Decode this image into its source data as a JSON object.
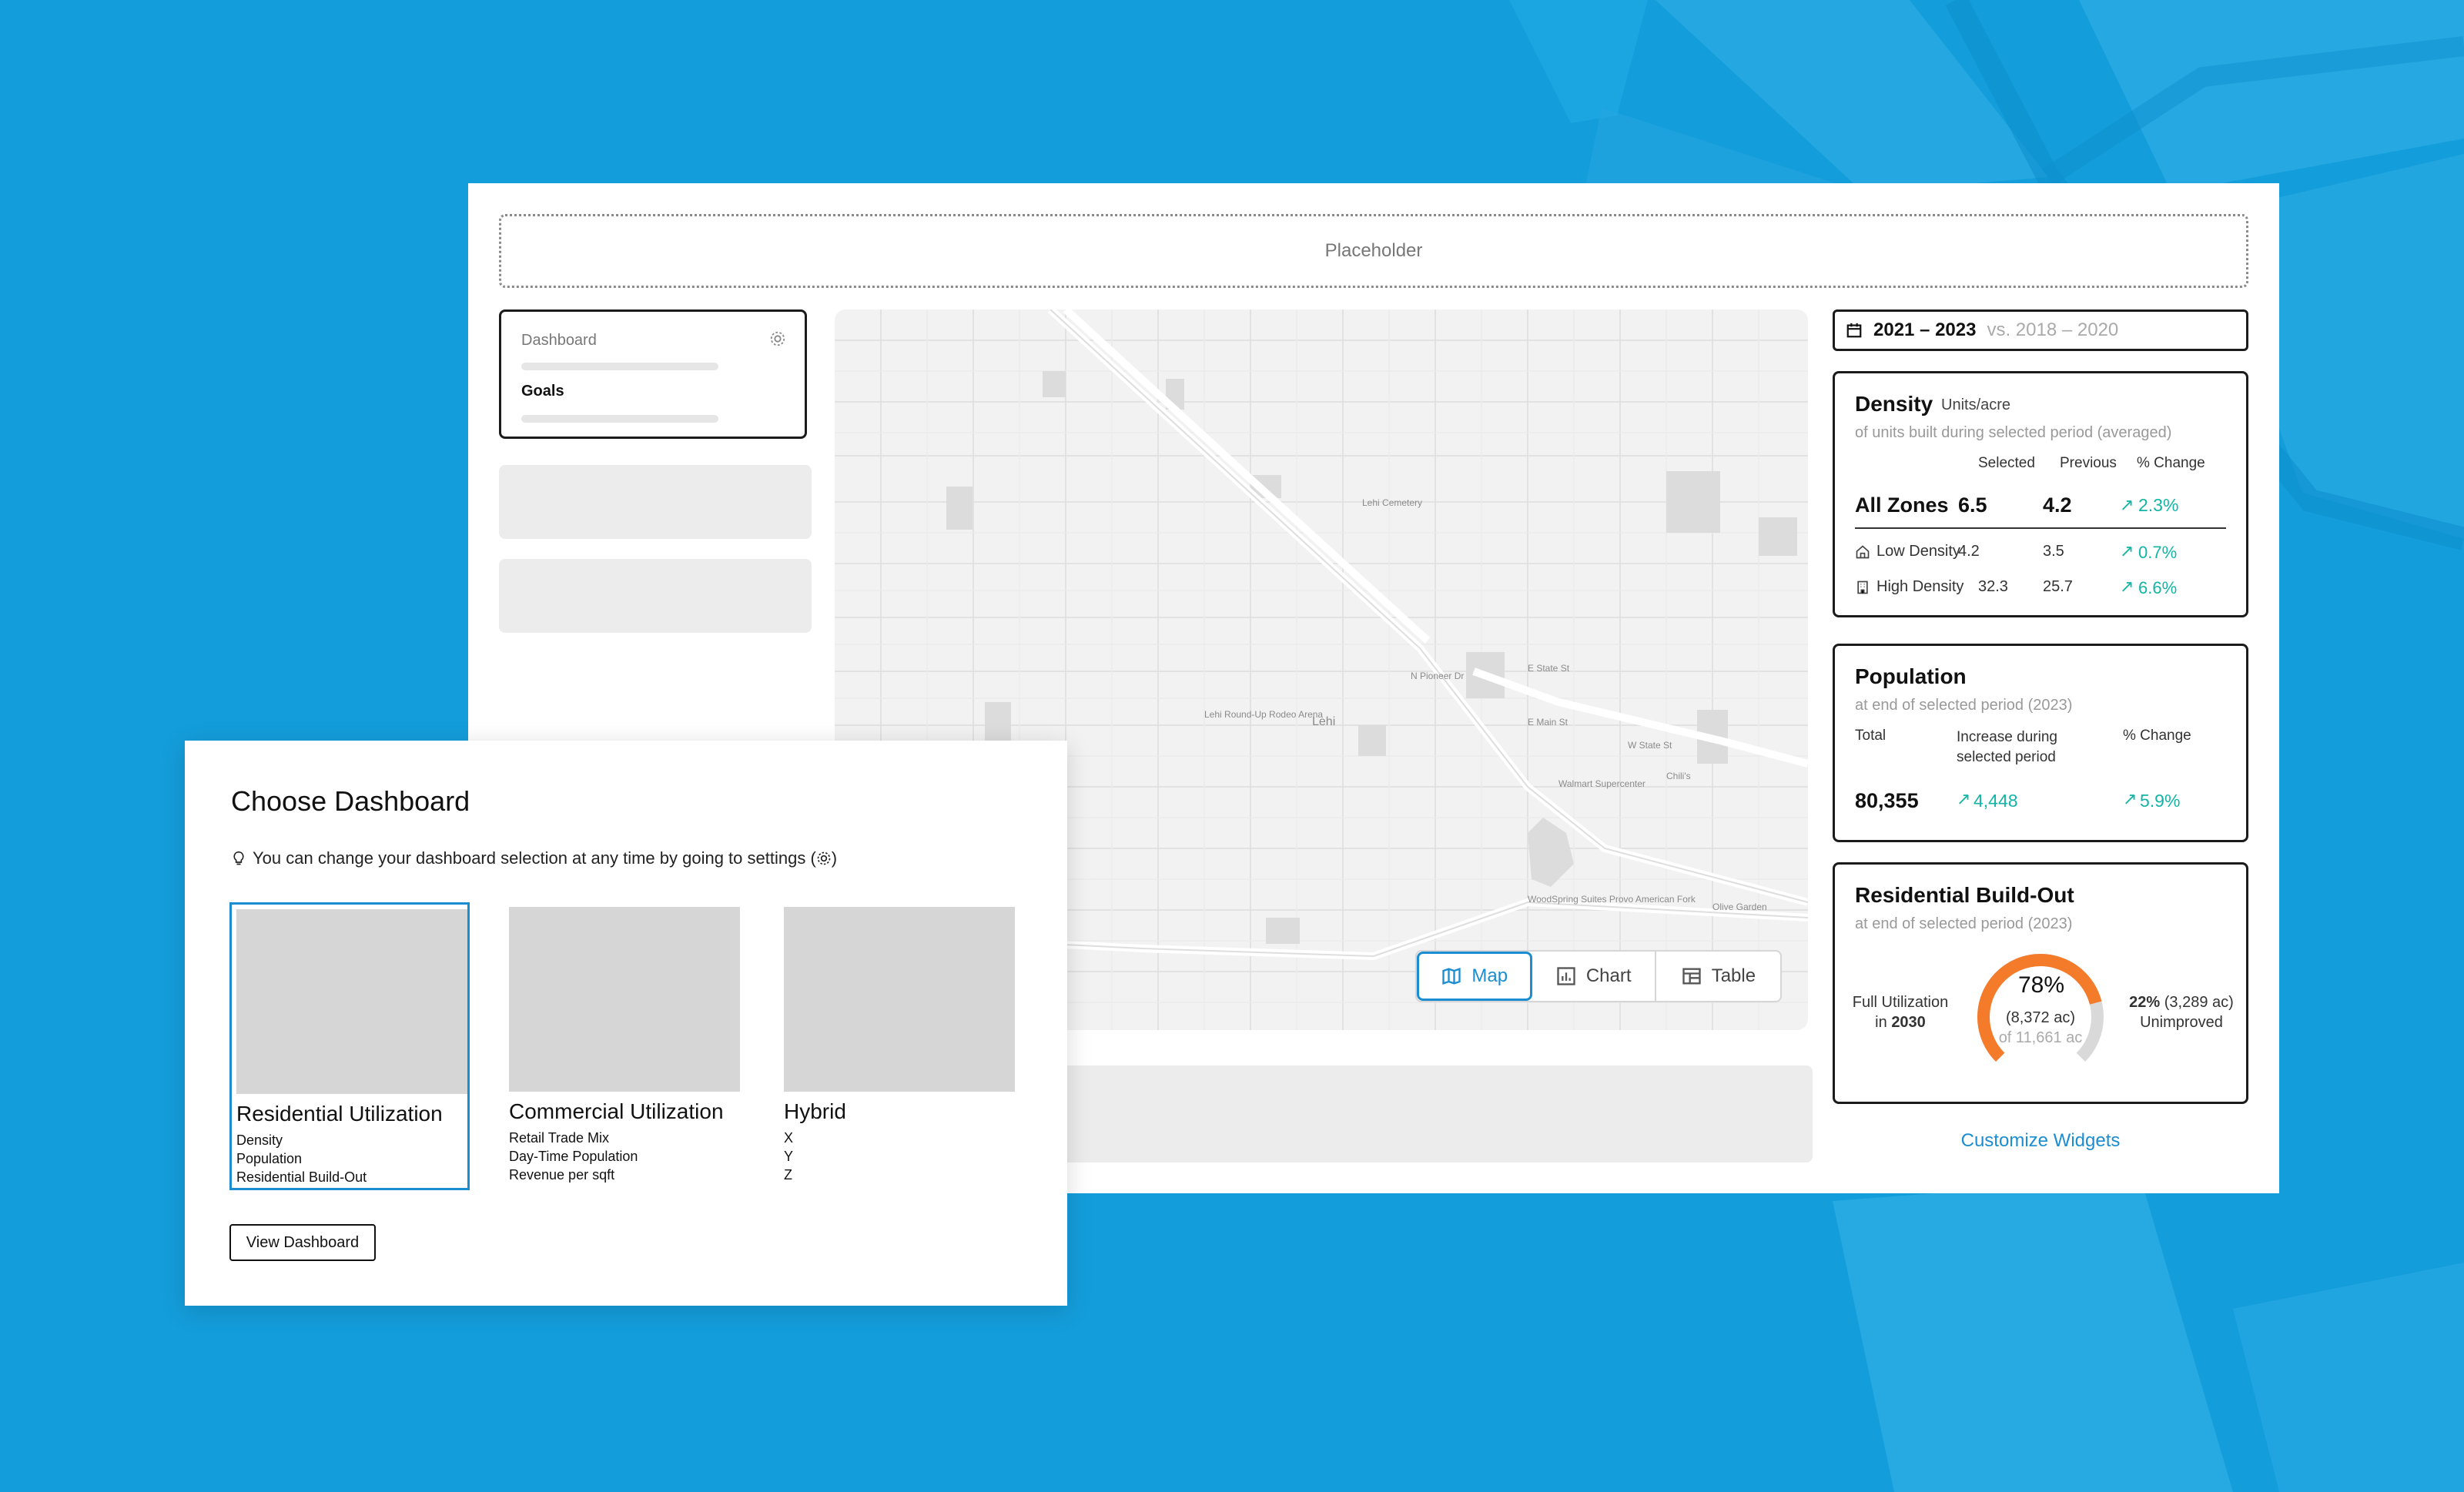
{
  "placeholder": "Placeholder",
  "sidebar": {
    "dashboard_label": "Dashboard",
    "goals_label": "Goals"
  },
  "view_toggle": {
    "map": "Map",
    "chart": "Chart",
    "table": "Table"
  },
  "date_range": {
    "selected": "2021 – 2023",
    "previous": "vs. 2018 – 2020"
  },
  "density": {
    "title": "Density",
    "unit": "Units/acre",
    "subtitle": "of units built during selected period (averaged)",
    "columns": [
      "Selected",
      "Previous",
      "% Change"
    ],
    "all_zones": {
      "label": "All Zones",
      "selected": "6.5",
      "previous": "4.2",
      "change": "2.3%"
    },
    "rows": [
      {
        "label": "Low Density",
        "selected": "4.2",
        "previous": "3.5",
        "change": "0.7%",
        "icon": "house-icon"
      },
      {
        "label": "High Density",
        "selected": "32.3",
        "previous": "25.7",
        "change": "6.6%",
        "icon": "building-icon"
      }
    ]
  },
  "population": {
    "title": "Population",
    "subtitle": "at end of selected period (2023)",
    "col_total": "Total",
    "col_increase": "Increase during selected period",
    "col_change": "% Change",
    "total": "80,355",
    "increase": "4,448",
    "change": "5.9%"
  },
  "buildout": {
    "title": "Residential Build-Out",
    "subtitle": "at end of selected period (2023)",
    "left_label": "Full Utilization",
    "left_in": "in",
    "left_year": "2030",
    "percent": "78%",
    "acres": "(8,372 ac)",
    "of_total": "of 11,661 ac",
    "right_percent": "22%",
    "right_acres": "(3,289 ac)",
    "right_label": "Unimproved",
    "progress": 0.78,
    "progress_color": "#f47b2a",
    "track_color": "#d9d9d9"
  },
  "customize": "Customize Widgets",
  "map_labels": {
    "city": "Lehi",
    "cemetery": "Lehi Cemetery",
    "arena": "Lehi Round-Up Rodeo Arena",
    "walmart": "Walmart Supercenter",
    "chilis": "Chili's",
    "woodspring": "WoodSpring Suites Provo American Fork",
    "olive": "Olive Garden",
    "main": "E Main St",
    "state1": "E State St",
    "state2": "W State St",
    "pioneer": "N Pioneer Dr"
  },
  "dialog": {
    "title": "Choose Dashboard",
    "hint": "You can change your dashboard selection at any time by going to settings (",
    "hint_end": ")",
    "options": [
      {
        "title": "Residential Utilization",
        "items": [
          "Density",
          "Population",
          "Residential Build-Out"
        ]
      },
      {
        "title": "Commercial Utilization",
        "items": [
          "Retail Trade Mix",
          "Day-Time Population",
          "Revenue per sqft"
        ]
      },
      {
        "title": "Hybrid",
        "items": [
          "X",
          "Y",
          "Z"
        ]
      }
    ],
    "button": "View Dashboard"
  },
  "colors": {
    "accent": "#1c8dd0",
    "positive": "#12b5a5",
    "background": "#149ddb"
  }
}
